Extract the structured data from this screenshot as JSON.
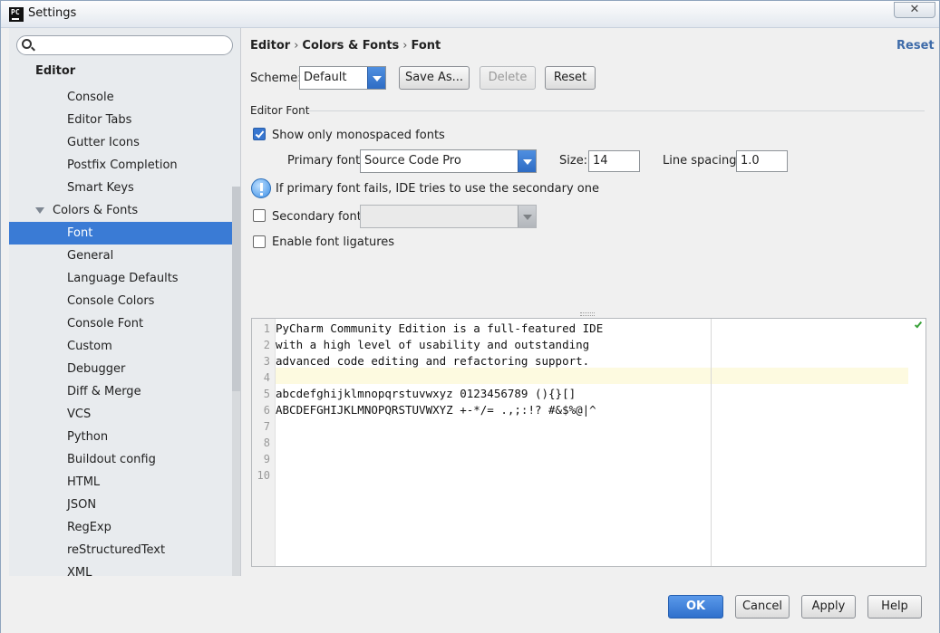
{
  "window": {
    "title": "Settings",
    "close_glyph": "✕"
  },
  "sidebar": {
    "search": {
      "value": "",
      "placeholder": ""
    },
    "items": [
      {
        "label": "Editor",
        "level": 0
      },
      {
        "label": "Console",
        "level": 1
      },
      {
        "label": "Editor Tabs",
        "level": 1
      },
      {
        "label": "Gutter Icons",
        "level": 1
      },
      {
        "label": "Postfix Completion",
        "level": 1
      },
      {
        "label": "Smart Keys",
        "level": 1
      },
      {
        "label": "Colors & Fonts",
        "level": 1,
        "expanded": true
      },
      {
        "label": "Font",
        "level": 2,
        "selected": true
      },
      {
        "label": "General",
        "level": 2
      },
      {
        "label": "Language Defaults",
        "level": 2
      },
      {
        "label": "Console Colors",
        "level": 2
      },
      {
        "label": "Console Font",
        "level": 2
      },
      {
        "label": "Custom",
        "level": 2
      },
      {
        "label": "Debugger",
        "level": 2
      },
      {
        "label": "Diff & Merge",
        "level": 2
      },
      {
        "label": "VCS",
        "level": 2
      },
      {
        "label": "Python",
        "level": 2
      },
      {
        "label": "Buildout config",
        "level": 2
      },
      {
        "label": "HTML",
        "level": 2
      },
      {
        "label": "JSON",
        "level": 2
      },
      {
        "label": "RegExp",
        "level": 2
      },
      {
        "label": "reStructuredText",
        "level": 2
      },
      {
        "label": "XML",
        "level": 2
      }
    ]
  },
  "header": {
    "breadcrumb": [
      "Editor",
      "Colors & Fonts",
      "Font"
    ],
    "separator": "›",
    "reset_link": "Reset"
  },
  "scheme": {
    "label": "Scheme:",
    "value": "Default",
    "save_as": "Save As...",
    "delete": "Delete",
    "reset": "Reset"
  },
  "editor_font": {
    "section_title": "Editor Font",
    "monospaced_label": "Show only monospaced fonts",
    "monospaced_checked": true,
    "primary_label": "Primary font:",
    "primary_value": "Source Code Pro",
    "size_label": "Size:",
    "size_value": "14",
    "spacing_label": "Line spacing:",
    "spacing_value": "1.0",
    "info_text": "If primary font fails, IDE tries to use the secondary one",
    "secondary_label": "Secondary font:",
    "secondary_checked": false,
    "secondary_value": "",
    "ligatures_label": "Enable font ligatures",
    "ligatures_checked": false
  },
  "preview": {
    "line_numbers": [
      "1",
      "2",
      "3",
      "4",
      "5",
      "6",
      "7",
      "8",
      "9",
      "10"
    ],
    "lines": [
      "PyCharm Community Edition is a full-featured IDE",
      "with a high level of usability and outstanding",
      "advanced code editing and refactoring support.",
      "",
      "abcdefghijklmnopqrstuvwxyz 0123456789 (){}[]",
      "ABCDEFGHIJKLMNOPQRSTUVWXYZ +-*/= .,;:!? #&$%@|^",
      "",
      "",
      "",
      ""
    ]
  },
  "footer": {
    "ok": "OK",
    "cancel": "Cancel",
    "apply": "Apply",
    "help": "Help"
  },
  "colors": {
    "accent": "#3a7bd5",
    "link": "#3e6ba9",
    "current_line": "#fdfae0"
  }
}
